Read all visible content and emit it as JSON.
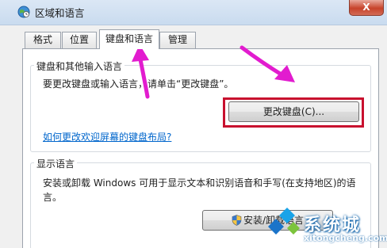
{
  "window": {
    "title": "区域和语言",
    "close_label": "X"
  },
  "tabs": [
    {
      "label": "格式"
    },
    {
      "label": "位置"
    },
    {
      "label": "键盘和语言",
      "active": true
    },
    {
      "label": "管理"
    }
  ],
  "keyboard_group": {
    "title": "键盘和其他输入语言",
    "description": "要更改键盘或输入语言，请单击“更改键盘”。",
    "change_keyboard_button": "更改键盘(C)...",
    "welcome_layout_link": "如何更改欢迎屏幕的键盘布局?"
  },
  "display_language_group": {
    "title": "显示语言",
    "description_line1": "安装或卸载 Windows 可用于显示文本和识别语音和手写(在支持地区)的语",
    "description_line2": "言。",
    "install_button": "安装/卸载语言"
  },
  "annotations": {
    "arrow_color": "#e21ccf",
    "highlight_color": "#c8102e"
  },
  "watermark": {
    "brand": "系统城",
    "url": "xitongcheng.com"
  }
}
